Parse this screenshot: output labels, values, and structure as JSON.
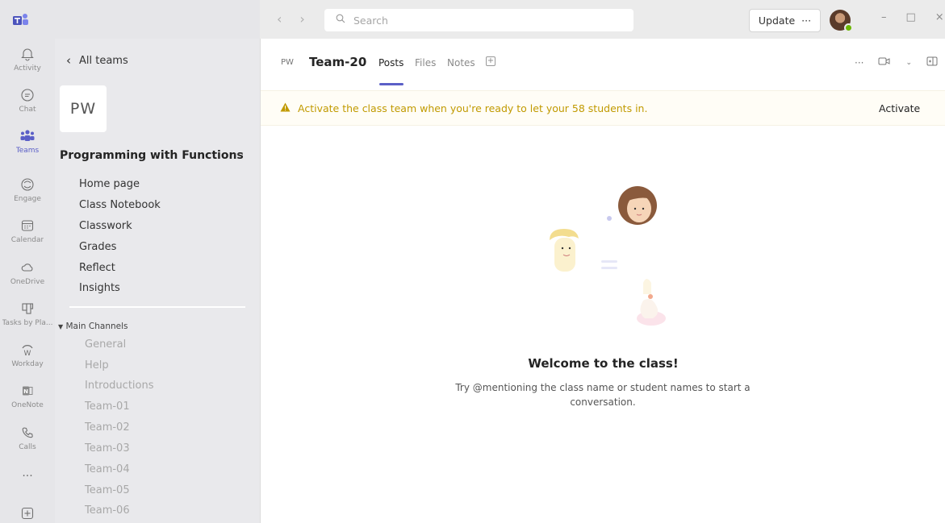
{
  "titlebar": {
    "logo_icon": "teams-logo-icon",
    "back_icon": "chevron-left-icon",
    "forward_icon": "chevron-right-icon",
    "search_placeholder": "Search",
    "update_label": "Update",
    "update_more": "···",
    "window_controls": [
      "–",
      "□",
      "×"
    ]
  },
  "rail": {
    "items": [
      {
        "label": "Activity",
        "icon": "bell-icon"
      },
      {
        "label": "Chat",
        "icon": "chat-icon"
      },
      {
        "label": "Teams",
        "icon": "teams-icon",
        "active": true
      },
      {
        "label": "Engage",
        "icon": "engage-icon"
      },
      {
        "label": "Calendar",
        "icon": "calendar-icon"
      },
      {
        "label": "OneDrive",
        "icon": "cloud-icon"
      },
      {
        "label": "Tasks by Pla...",
        "icon": "planner-icon"
      },
      {
        "label": "Workday",
        "icon": "workday-icon"
      },
      {
        "label": "OneNote",
        "icon": "onenote-icon"
      },
      {
        "label": "Calls",
        "icon": "phone-icon"
      }
    ],
    "more": "···",
    "add_apps_icon": "plus-icon"
  },
  "leftpanel": {
    "back_label": "All teams",
    "team_tile": "PW",
    "team_name": "Programming with Functions",
    "team_more": "···",
    "menu": [
      "Home page",
      "Class Notebook",
      "Classwork",
      "Grades",
      "Reflect",
      "Insights"
    ],
    "channels_title": "Main Channels",
    "channels": [
      "General",
      "Help",
      "Introductions",
      "Team-01",
      "Team-02",
      "Team-03",
      "Team-04",
      "Team-05",
      "Team-06"
    ]
  },
  "main": {
    "team_abbr": "PW",
    "channel_title": "Team-20",
    "tabs": [
      {
        "label": "Posts",
        "active": true
      },
      {
        "label": "Files"
      },
      {
        "label": "Notes"
      }
    ],
    "add_tab": "+",
    "more": "···",
    "banner": {
      "message": "Activate the class team when you're ready to let your 58 students in.",
      "action": "Activate",
      "accent": "#c19a00"
    },
    "empty_state": {
      "title": "Welcome to the class!",
      "subtitle": "Try @mentioning the class name or student names to start a conversation."
    }
  },
  "colors": {
    "brand": "#5b5fc7",
    "rail_bg": "#e6e6e9",
    "panel_bg": "#e9e9ec"
  }
}
